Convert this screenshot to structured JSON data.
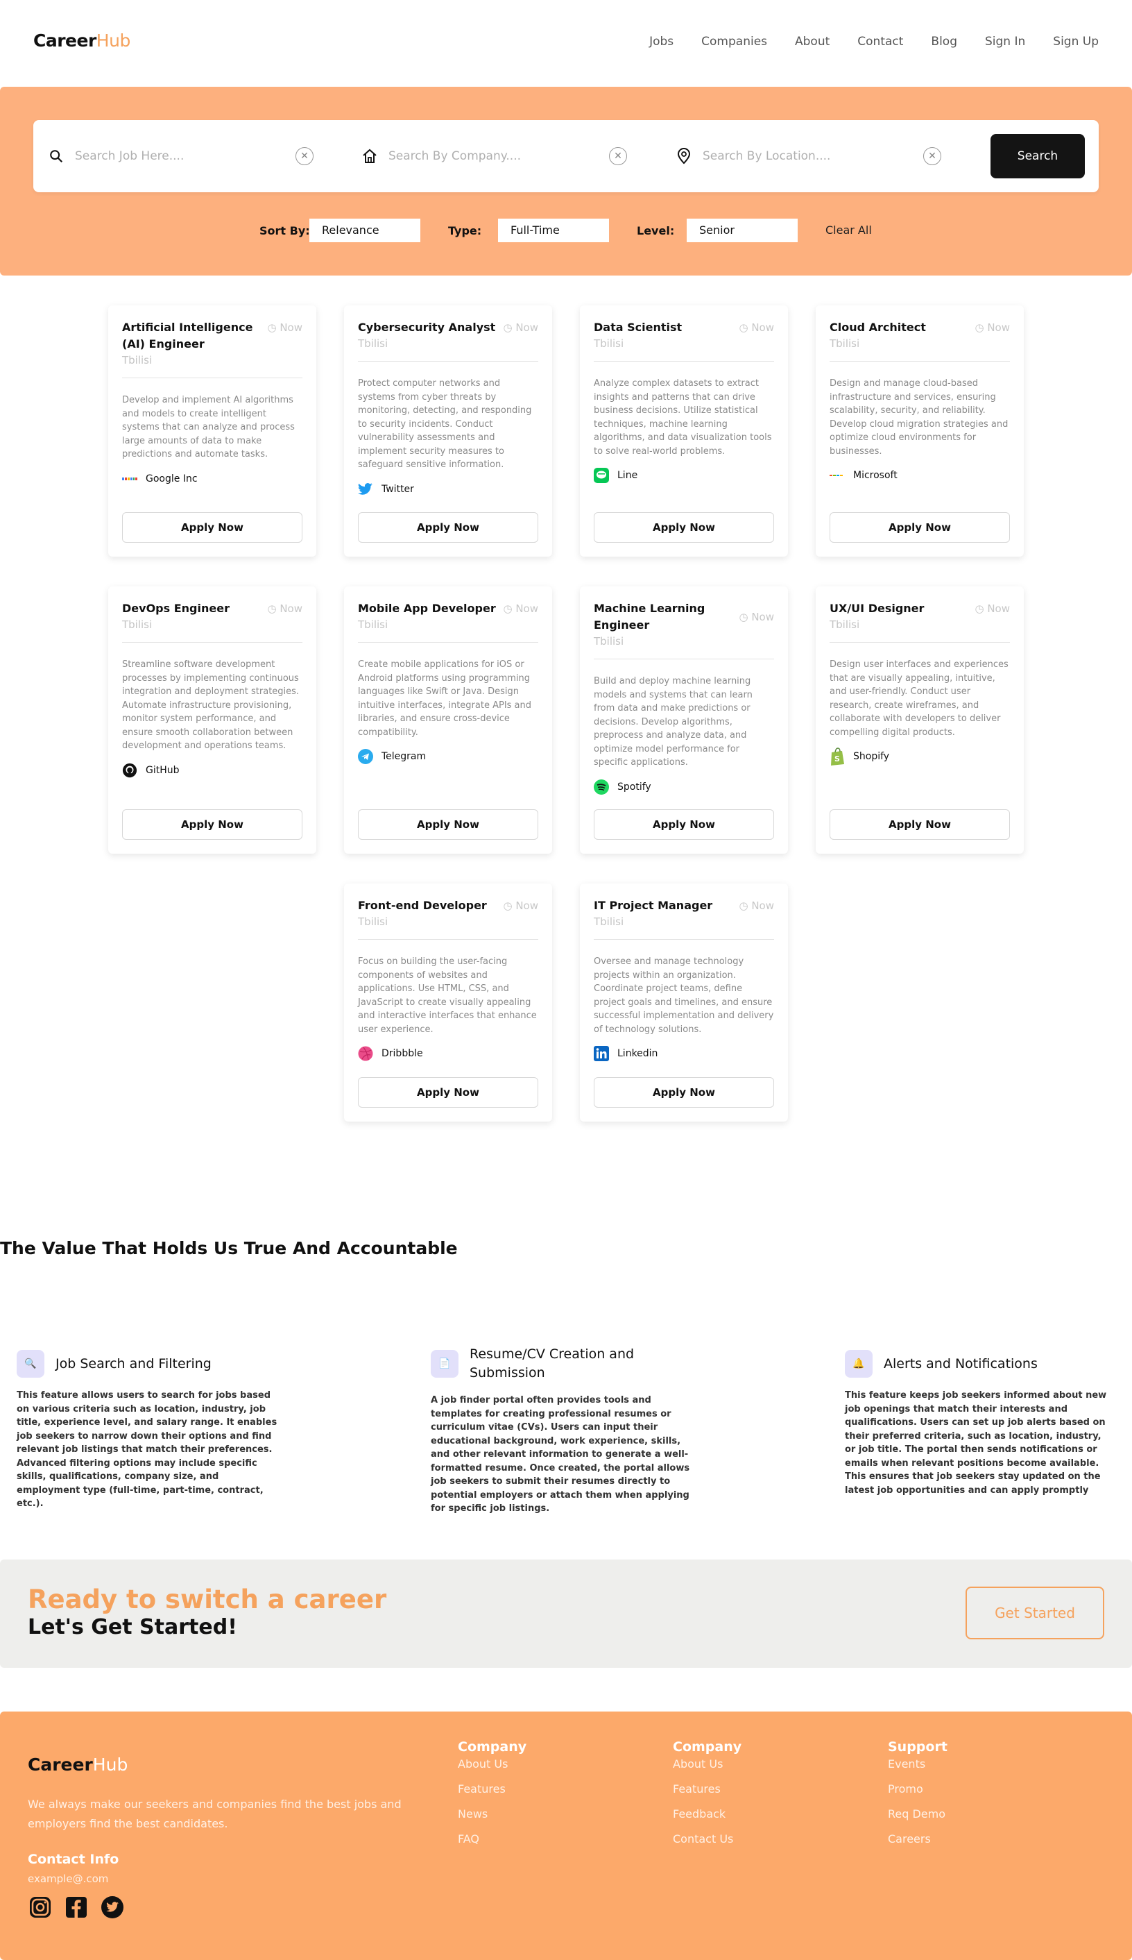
{
  "brand": {
    "logo_main": "Career",
    "logo_accent": "Hub"
  },
  "nav": [
    "Jobs",
    "Companies",
    "About",
    "Contact",
    "Blog",
    "Sign In",
    "Sign Up"
  ],
  "search": {
    "job_placeholder": "Search Job Here....",
    "company_placeholder": "Search By Company....",
    "location_placeholder": "Search By Location....",
    "button": "Search"
  },
  "filters": {
    "sort_label": "Sort By:",
    "sort_value": "Relevance",
    "type_label": "Type:",
    "type_value": "Full-Time",
    "level_label": "Level:",
    "level_value": "Senior",
    "clear": "Clear All"
  },
  "jobs": [
    {
      "title": "Artificial Intelligence (AI) Engineer",
      "time": "Now",
      "location": "Tbilisi",
      "description": "Develop and implement AI algorithms and models to create intelligent systems that can analyze and process large amounts of data to make predictions and automate tasks.",
      "company": "Google Inc",
      "apply": "Apply Now"
    },
    {
      "title": "Cybersecurity Analyst",
      "time": "Now",
      "location": "Tbilisi",
      "description": "Protect computer networks and systems from cyber threats by monitoring, detecting, and responding to security incidents. Conduct vulnerability assessments and implement security measures to safeguard sensitive information.",
      "company": "Twitter",
      "apply": "Apply Now"
    },
    {
      "title": "Data Scientist",
      "time": "Now",
      "location": "Tbilisi",
      "description": "Analyze complex datasets to extract insights and patterns that can drive business decisions. Utilize statistical techniques, machine learning algorithms, and data visualization tools to solve real-world problems.",
      "company": "Line",
      "apply": "Apply Now"
    },
    {
      "title": "Cloud Architect",
      "time": "Now",
      "location": "Tbilisi",
      "description": "Design and manage cloud-based infrastructure and services, ensuring scalability, security, and reliability. Develop cloud migration strategies and optimize cloud environments for businesses.",
      "company": "Microsoft",
      "apply": "Apply Now"
    },
    {
      "title": "DevOps Engineer",
      "time": "Now",
      "location": "Tbilisi",
      "description": "Streamline software development processes by implementing continuous integration and deployment strategies. Automate infrastructure provisioning, monitor system performance, and ensure smooth collaboration between development and operations teams.",
      "company": "GitHub",
      "apply": "Apply Now"
    },
    {
      "title": "Mobile App Developer",
      "time": "Now",
      "location": "Tbilisi",
      "description": "Create mobile applications for iOS or Android platforms using programming languages like Swift or Java. Design intuitive interfaces, integrate APIs and libraries, and ensure cross-device compatibility.",
      "company": "Telegram",
      "apply": "Apply Now"
    },
    {
      "title": "Machine Learning Engineer",
      "time": "Now",
      "location": "Tbilisi",
      "description": "Build and deploy machine learning models and systems that can learn from data and make predictions or decisions. Develop algorithms, preprocess and analyze data, and optimize model performance for specific applications.",
      "company": "Spotify",
      "apply": "Apply Now"
    },
    {
      "title": "UX/UI Designer",
      "time": "Now",
      "location": "Tbilisi",
      "description": "Design user interfaces and experiences that are visually appealing, intuitive, and user-friendly. Conduct user research, create wireframes, and collaborate with developers to deliver compelling digital products.",
      "company": "Shopify",
      "apply": "Apply Now"
    },
    {
      "title": "Front-end Developer",
      "time": "Now",
      "location": "Tbilisi",
      "description": "Focus on building the user-facing components of websites and applications. Use HTML, CSS, and JavaScript to create visually appealing and interactive interfaces that enhance user experience.",
      "company": "Dribbble",
      "apply": "Apply Now"
    },
    {
      "title": "IT Project Manager",
      "time": "Now",
      "location": "Tbilisi",
      "description": "Oversee and manage technology projects within an organization. Coordinate project teams, define project goals and timelines, and ensure successful implementation and delivery of technology solutions.",
      "company": "Linkedin",
      "apply": "Apply Now"
    }
  ],
  "values": {
    "title": "The Value That Holds Us True And Accountable",
    "features": [
      {
        "icon": "magnifier-icon",
        "title": "Job Search and Filtering",
        "description": "This feature allows users to search for jobs based on various criteria such as location, industry, job title, experience level, and salary range. It enables job seekers to narrow down their options and find relevant job listings that match their preferences. Advanced filtering options may include specific skills, qualifications, company size, and employment type (full-time, part-time, contract, etc.)."
      },
      {
        "icon": "document-icon",
        "title": "Resume/CV Creation and Submission",
        "description": "A job finder portal often provides tools and templates for creating professional resumes or curriculum vitae (CVs). Users can input their educational background, work experience, skills, and other relevant information to generate a well-formatted resume. Once created, the portal allows job seekers to submit their resumes directly to potential employers or attach them when applying for specific job listings."
      },
      {
        "icon": "bell-icon",
        "title": "Alerts and Notifications",
        "description": "This feature keeps job seekers informed about new job openings that match their interests and qualifications. Users can set up job alerts based on their preferred criteria, such as location, industry, or job title. The portal then sends notifications or emails when relevant positions become available. This ensures that job seekers stay updated on the latest job opportunities and can apply promptly"
      }
    ]
  },
  "cta": {
    "line1": "Ready to switch a career",
    "line2": "Let's Get Started!",
    "button": "Get Started"
  },
  "footer": {
    "logo_main": "Career",
    "logo_accent": "Hub",
    "tagline": "We always make our seekers and companies find the best jobs and employers find the best candidates.",
    "contact_title": "Contact Info",
    "email": "example@.com",
    "columns": [
      {
        "title": "Company",
        "links": [
          "About Us",
          "Features",
          "News",
          "FAQ"
        ]
      },
      {
        "title": "Company",
        "links": [
          "About Us",
          "Features",
          "Feedback",
          "Contact Us"
        ]
      },
      {
        "title": "Support",
        "links": [
          "Events",
          "Promo",
          "Req Demo",
          "Careers"
        ]
      }
    ]
  },
  "colors": {
    "accent": "#f5a25d",
    "band": "#fdb07e",
    "footer": "#fca96a",
    "button_dark": "#141414"
  }
}
